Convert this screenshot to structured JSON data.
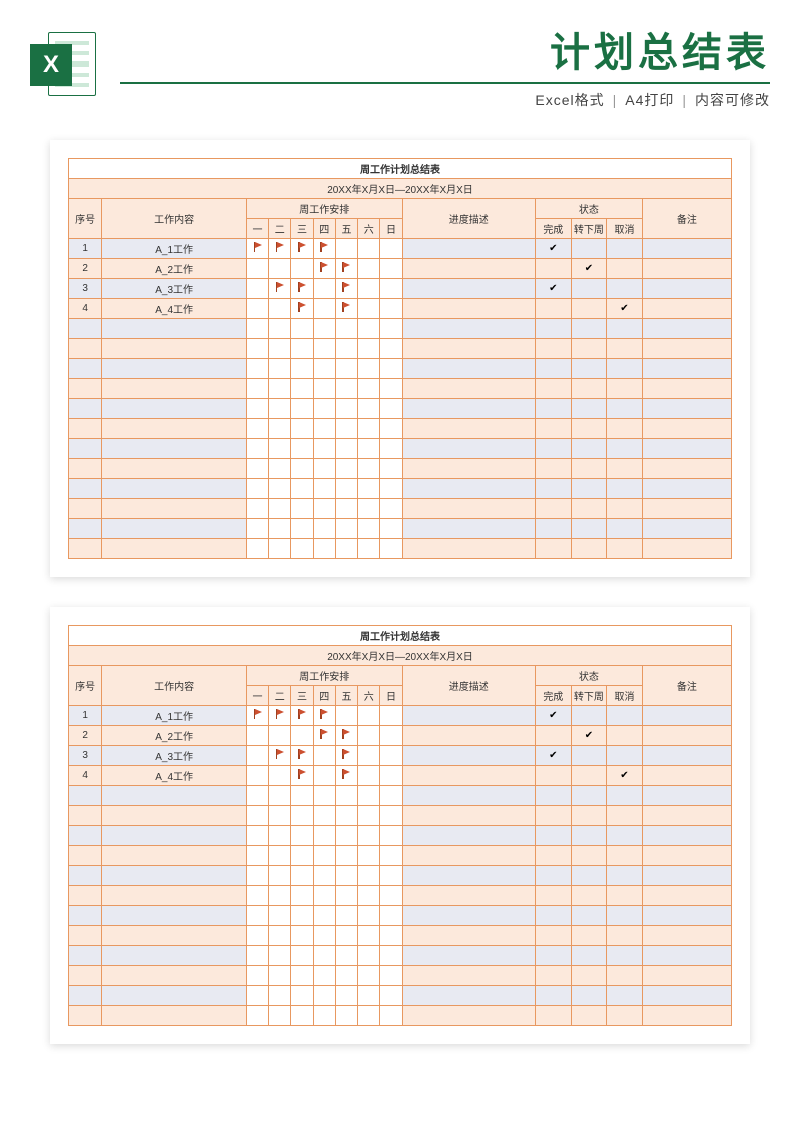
{
  "header": {
    "icon_letter": "X",
    "title": "计划总结表",
    "sub1": "Excel格式",
    "sub2": "A4打印",
    "sub3": "内容可修改"
  },
  "sheet": {
    "title": "周工作计划总结表",
    "date_range": "20XX年X月X日—20XX年X月X日",
    "col_seq": "序号",
    "col_work": "工作内容",
    "col_schedule": "周工作安排",
    "col_progress": "进度描述",
    "col_status": "状态",
    "col_note": "备注",
    "days": [
      "一",
      "二",
      "三",
      "四",
      "五",
      "六",
      "日"
    ],
    "status_labels": [
      "完成",
      "转下周",
      "取消"
    ],
    "rows": [
      {
        "seq": "1",
        "work": "A_1工作",
        "flags": [
          1,
          1,
          1,
          1,
          0,
          0,
          0
        ],
        "status": [
          1,
          0,
          0
        ]
      },
      {
        "seq": "2",
        "work": "A_2工作",
        "flags": [
          0,
          0,
          0,
          1,
          1,
          0,
          0
        ],
        "status": [
          0,
          1,
          0
        ]
      },
      {
        "seq": "3",
        "work": "A_3工作",
        "flags": [
          0,
          1,
          1,
          0,
          1,
          0,
          0
        ],
        "status": [
          1,
          0,
          0
        ]
      },
      {
        "seq": "4",
        "work": "A_4工作",
        "flags": [
          0,
          0,
          1,
          0,
          1,
          0,
          0
        ],
        "status": [
          0,
          0,
          1
        ]
      }
    ],
    "empty_rows": 12
  }
}
